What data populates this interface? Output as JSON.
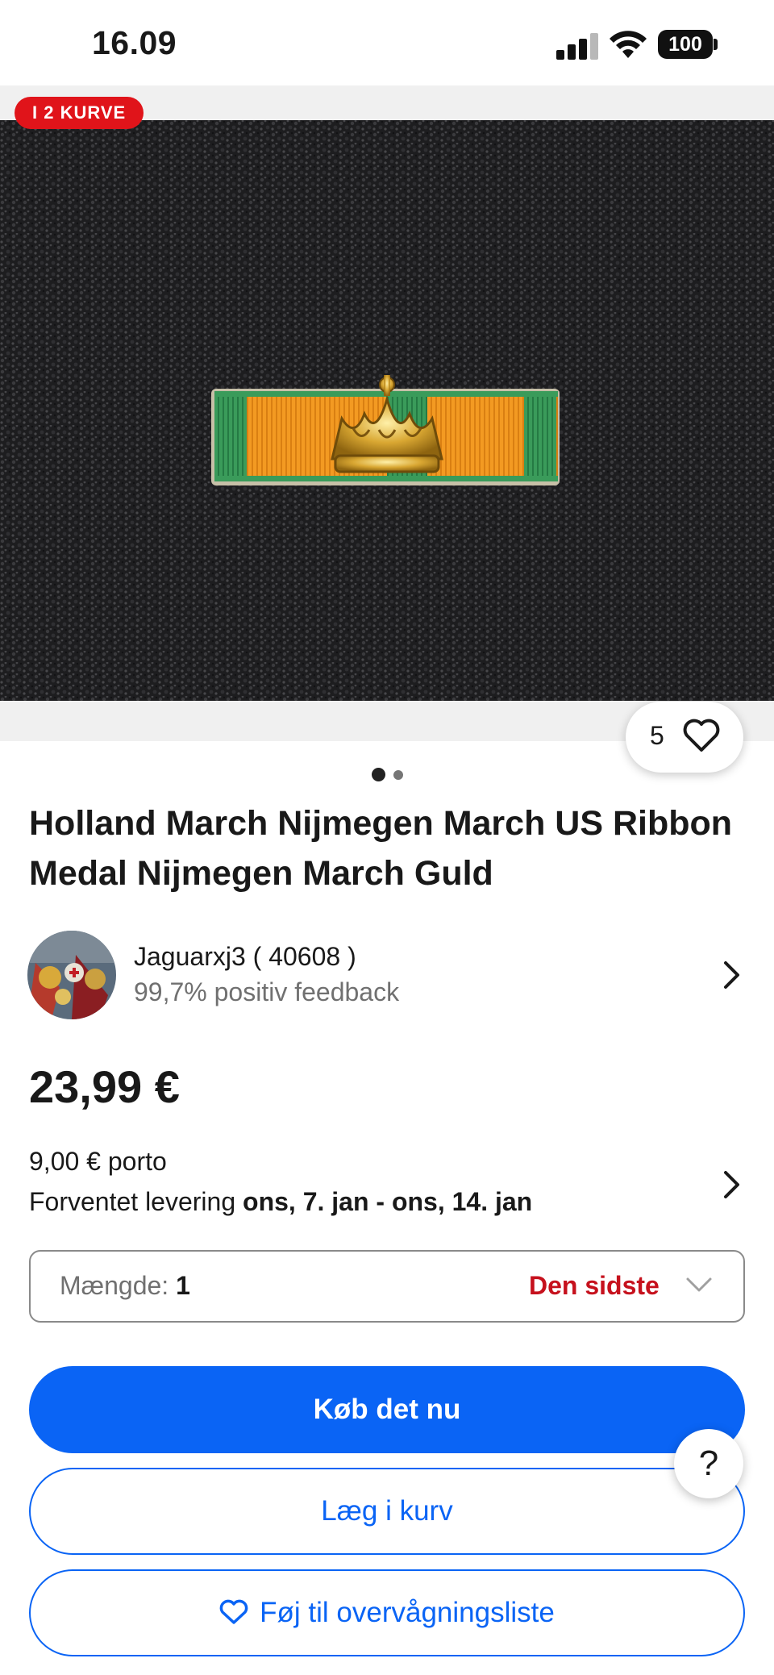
{
  "status_bar": {
    "time": "16.09",
    "battery": "100",
    "icons": [
      "signal-icon",
      "wifi-icon",
      "battery-icon"
    ]
  },
  "gallery": {
    "cart_badge": "I 2 KURVE",
    "watch_count": "5",
    "image_count": 2,
    "active_image": 1,
    "image_description_icon": "product-photo"
  },
  "listing": {
    "title": "Holland March Nijmegen March US Ribbon Medal Nijmegen March Guld"
  },
  "seller": {
    "name": "Jaguarxj3 ( 40608 )",
    "feedback": "99,7% positiv feedback"
  },
  "price": "23,99 €",
  "shipping": {
    "cost": "9,00 € porto",
    "delivery_prefix": "Forventet levering",
    "delivery_dates": "ons, 7. jan - ons, 14. jan"
  },
  "quantity": {
    "label": "Mængde:",
    "value": "1",
    "warning": "Den sidste"
  },
  "buttons": {
    "buy_now": "Køb det nu",
    "add_to_cart": "Læg i kurv",
    "watchlist": "Føj til overvågningsliste"
  },
  "help": {
    "label": "?"
  },
  "colors": {
    "primary_blue": "#0a64f5",
    "badge_red": "#e0141a",
    "warning_red": "#c6111d"
  }
}
